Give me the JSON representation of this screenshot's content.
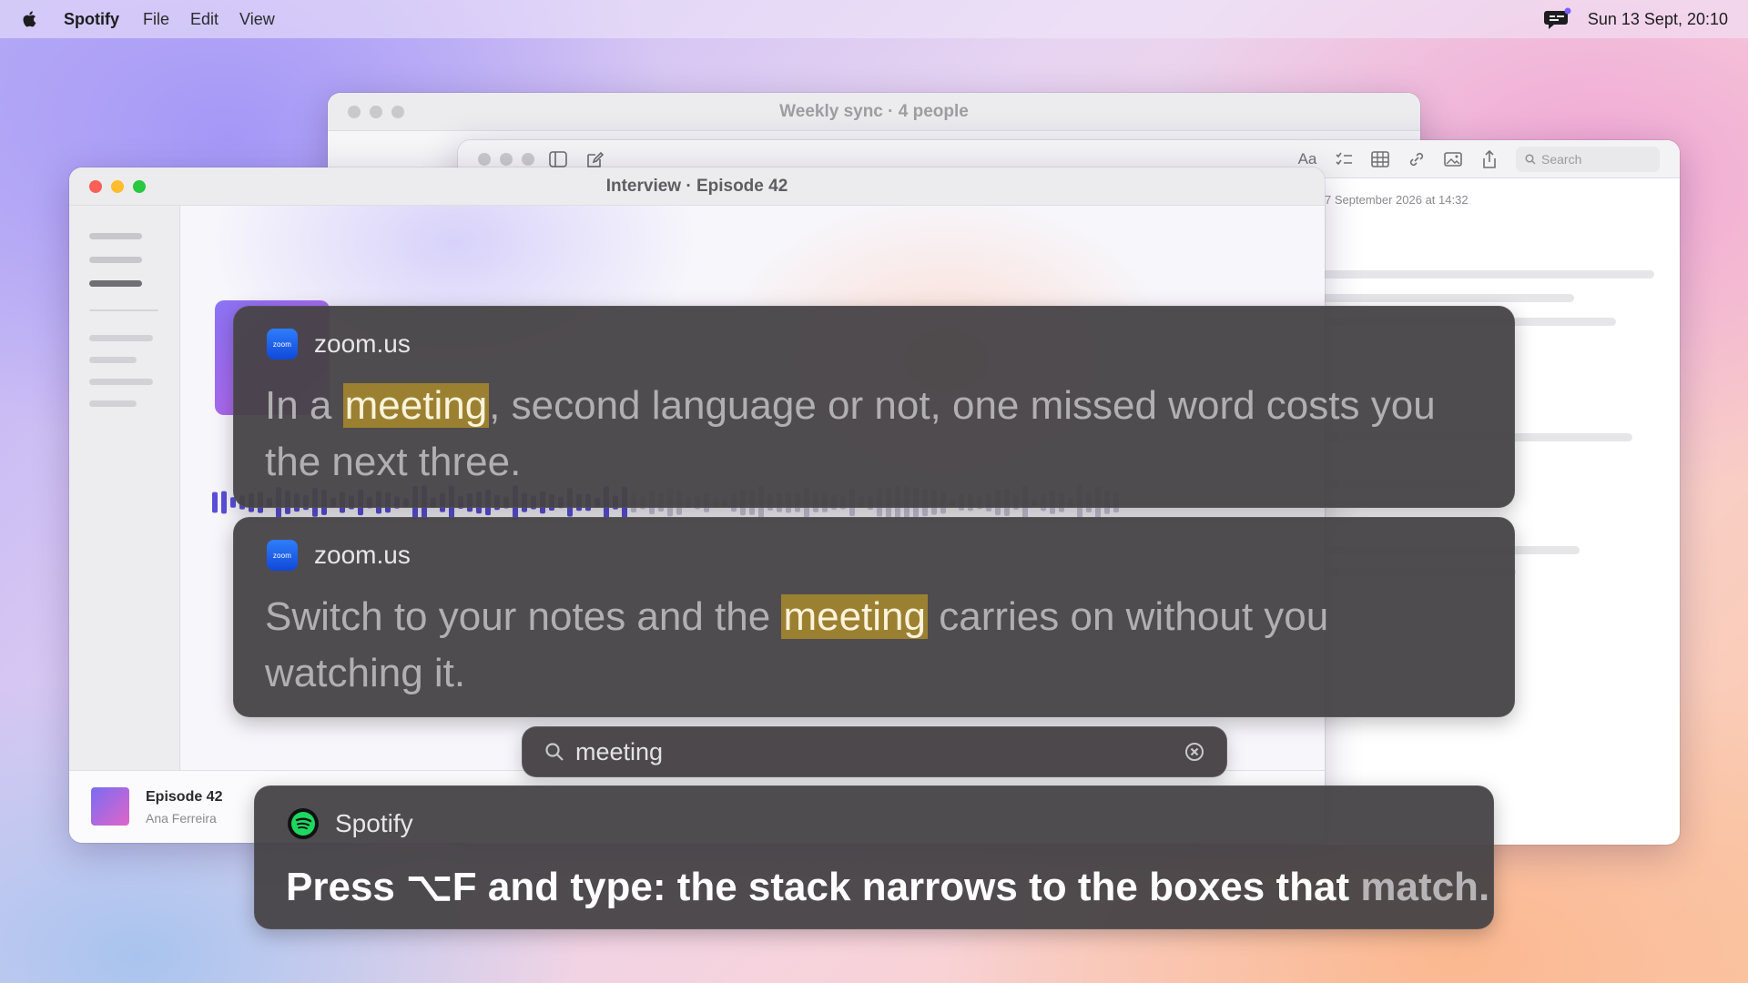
{
  "menubar": {
    "app_name": "Spotify",
    "menus": [
      "File",
      "Edit",
      "View"
    ],
    "clock": "Sun 13 Sept, 20:10"
  },
  "windows": {
    "weekly_sync": {
      "title": "Weekly sync · 4 people"
    },
    "notes": {
      "search_placeholder": "Search",
      "text_style_label": "Aa",
      "date": "7 September 2026 at 14:32"
    },
    "interview": {
      "title": "Interview · Episode 42",
      "footer": {
        "episode_title": "Episode 42",
        "author": "Ana Ferreira"
      }
    }
  },
  "captions": [
    {
      "app": "zoom.us",
      "icon_label": "zoom",
      "text_before": "In a ",
      "match": "meeting",
      "text_after": ", second language or not, one missed word costs you the next three."
    },
    {
      "app": "zoom.us",
      "icon_label": "zoom",
      "text_before": "Switch to your notes and the ",
      "match": "meeting",
      "text_after": " carries on without you watching it."
    },
    {
      "app": "Spotify",
      "text_main": "Press ⌥F and type: the stack narrows to the boxes that ",
      "text_dim": "match."
    }
  ],
  "search": {
    "query": "meeting"
  },
  "colors": {
    "highlight": "#9c8032",
    "card_bg": "#464246",
    "zoom_blue": "#2f7dfc",
    "spotify_green": "#1ed760"
  }
}
